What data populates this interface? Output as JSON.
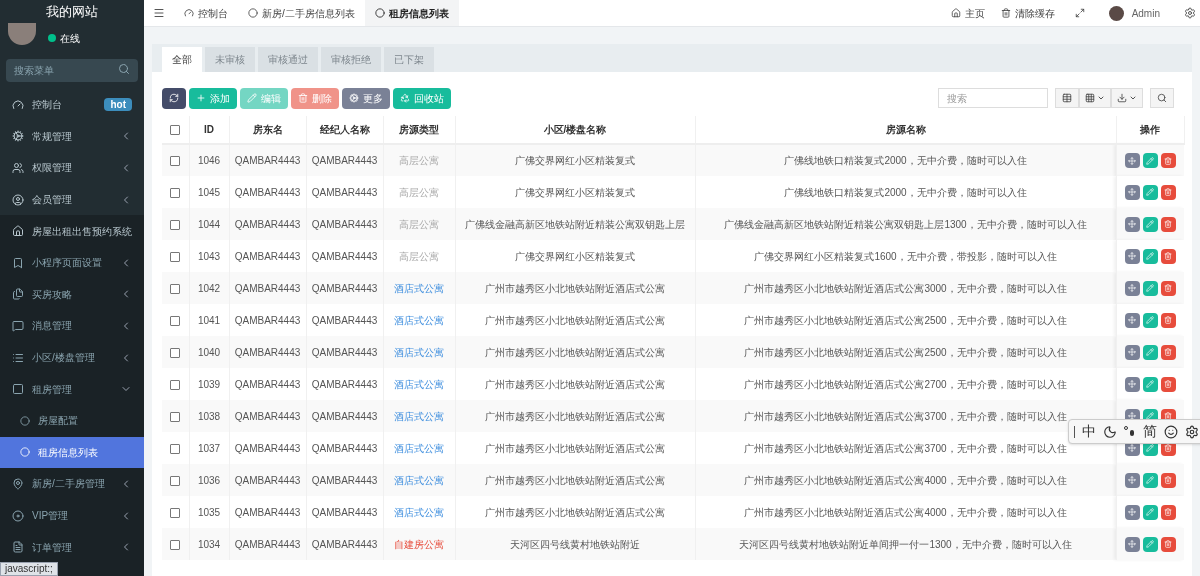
{
  "sidebar": {
    "logo": "我的网站",
    "user": {
      "status": "在线"
    },
    "search": {
      "placeholder": "搜索菜单"
    },
    "items": [
      {
        "label": "控制台",
        "badge": "hot",
        "selected": false
      },
      {
        "label": "常规管理",
        "expanded": false,
        "selected": false
      },
      {
        "label": "权限管理",
        "expanded": false,
        "selected": false
      },
      {
        "label": "会员管理",
        "expanded": false,
        "selected": false
      },
      {
        "label": "房屋出租出售预约系统",
        "expanded": true,
        "selected": false,
        "children": [
          {
            "label": "小程序页面设置",
            "expanded": false,
            "selected": false
          },
          {
            "label": "买房攻略",
            "expanded": false,
            "selected": false
          },
          {
            "label": "消息管理",
            "expanded": false,
            "selected": false
          },
          {
            "label": "小区/楼盘管理",
            "expanded": false,
            "selected": false
          },
          {
            "label": "租房管理",
            "expanded": true,
            "selected": false,
            "children": [
              {
                "label": "房屋配置",
                "selected": false
              },
              {
                "label": "租房信息列表",
                "selected": true
              }
            ]
          },
          {
            "label": "新房/二手房管理",
            "expanded": false,
            "selected": false
          },
          {
            "label": "VIP管理",
            "expanded": false,
            "selected": false
          },
          {
            "label": "订单管理",
            "expanded": false,
            "selected": false
          }
        ]
      }
    ]
  },
  "status_bar": "javascript:;",
  "top_tabs": [
    {
      "label": "控制台",
      "selected": false
    },
    {
      "label": "新房/二手房信息列表",
      "selected": false
    },
    {
      "label": "租房信息列表",
      "selected": true
    }
  ],
  "header_links": [
    {
      "label": "主页"
    },
    {
      "label": "清除缓存"
    }
  ],
  "user_name": "Admin",
  "filter_tabs": [
    {
      "label": "全部",
      "selected": true
    },
    {
      "label": "未审核",
      "selected": false
    },
    {
      "label": "审核通过",
      "selected": false
    },
    {
      "label": "审核拒绝",
      "selected": false
    },
    {
      "label": "已下架",
      "selected": false
    }
  ],
  "toolbar": [
    {
      "kind": "refresh",
      "disabled": false
    },
    {
      "kind": "add",
      "label": "添加",
      "disabled": false
    },
    {
      "kind": "edit",
      "label": "编辑",
      "disabled": true
    },
    {
      "kind": "delete",
      "label": "删除",
      "disabled": true
    },
    {
      "kind": "more",
      "label": "更多",
      "disabled": false
    },
    {
      "kind": "recycle",
      "label": "回收站",
      "disabled": false
    }
  ],
  "table_search": {
    "placeholder": "搜索"
  },
  "table": {
    "select_all_checked": false,
    "columns": [
      "ID",
      "房东名",
      "经纪人名称",
      "房源类型",
      "小区/楼盘名称",
      "房源名称",
      "操作"
    ],
    "rows": [
      {
        "checked": false,
        "id": "1046",
        "landlord": "QAMBAR4443",
        "agent": "QAMBAR4443",
        "type": {
          "kind": "high_rise",
          "text": "高层公寓"
        },
        "community": "广佛交界网红小区精装复式",
        "name": "广佛线地铁口精装复式2000，无中介费，随时可以入住"
      },
      {
        "checked": false,
        "id": "1045",
        "landlord": "QAMBAR4443",
        "agent": "QAMBAR4443",
        "type": {
          "kind": "high_rise",
          "text": "高层公寓"
        },
        "community": "广佛交界网红小区精装复式",
        "name": "广佛线地铁口精装复式2000，无中介费，随时可以入住"
      },
      {
        "checked": false,
        "id": "1044",
        "landlord": "QAMBAR4443",
        "agent": "QAMBAR4443",
        "type": {
          "kind": "high_rise",
          "text": "高层公寓"
        },
        "community": "广佛线金融高新区地铁站附近精装公寓双钥匙上层",
        "name": "广佛线金融高新区地铁站附近精装公寓双钥匙上层1300，无中介费，随时可以入住"
      },
      {
        "checked": false,
        "id": "1043",
        "landlord": "QAMBAR4443",
        "agent": "QAMBAR4443",
        "type": {
          "kind": "high_rise",
          "text": "高层公寓"
        },
        "community": "广佛交界网红小区精装复式",
        "name": "广佛交界网红小区精装复式1600，无中介费，带投影，随时可以入住"
      },
      {
        "checked": false,
        "id": "1042",
        "landlord": "QAMBAR4443",
        "agent": "QAMBAR4443",
        "type": {
          "kind": "hotel",
          "text": "酒店式公寓"
        },
        "community": "广州市越秀区小北地铁站附近酒店式公寓",
        "name": "广州市越秀区小北地铁站附近酒店式公寓3000，无中介费，随时可以入住"
      },
      {
        "checked": false,
        "id": "1041",
        "landlord": "QAMBAR4443",
        "agent": "QAMBAR4443",
        "type": {
          "kind": "hotel",
          "text": "酒店式公寓"
        },
        "community": "广州市越秀区小北地铁站附近酒店式公寓",
        "name": "广州市越秀区小北地铁站附近酒店式公寓2500，无中介费，随时可以入住"
      },
      {
        "checked": false,
        "id": "1040",
        "landlord": "QAMBAR4443",
        "agent": "QAMBAR4443",
        "type": {
          "kind": "hotel",
          "text": "酒店式公寓"
        },
        "community": "广州市越秀区小北地铁站附近酒店式公寓",
        "name": "广州市越秀区小北地铁站附近酒店式公寓2500，无中介费，随时可以入住"
      },
      {
        "checked": false,
        "id": "1039",
        "landlord": "QAMBAR4443",
        "agent": "QAMBAR4443",
        "type": {
          "kind": "hotel",
          "text": "酒店式公寓"
        },
        "community": "广州市越秀区小北地铁站附近酒店式公寓",
        "name": "广州市越秀区小北地铁站附近酒店式公寓2700，无中介费，随时可以入住"
      },
      {
        "checked": false,
        "id": "1038",
        "landlord": "QAMBAR4443",
        "agent": "QAMBAR4443",
        "type": {
          "kind": "hotel",
          "text": "酒店式公寓"
        },
        "community": "广州市越秀区小北地铁站附近酒店式公寓",
        "name": "广州市越秀区小北地铁站附近酒店式公寓3700，无中介费，随时可以入住"
      },
      {
        "checked": false,
        "id": "1037",
        "landlord": "QAMBAR4443",
        "agent": "QAMBAR4443",
        "type": {
          "kind": "hotel",
          "text": "酒店式公寓"
        },
        "community": "广州市越秀区小北地铁站附近酒店式公寓",
        "name": "广州市越秀区小北地铁站附近酒店式公寓3700，无中介费，随时可以入住"
      },
      {
        "checked": false,
        "id": "1036",
        "landlord": "QAMBAR4443",
        "agent": "QAMBAR4443",
        "type": {
          "kind": "hotel",
          "text": "酒店式公寓"
        },
        "community": "广州市越秀区小北地铁站附近酒店式公寓",
        "name": "广州市越秀区小北地铁站附近酒店式公寓4000，无中介费，随时可以入住"
      },
      {
        "checked": false,
        "id": "1035",
        "landlord": "QAMBAR4443",
        "agent": "QAMBAR4443",
        "type": {
          "kind": "hotel",
          "text": "酒店式公寓"
        },
        "community": "广州市越秀区小北地铁站附近酒店式公寓",
        "name": "广州市越秀区小北地铁站附近酒店式公寓4000，无中介费，随时可以入住"
      },
      {
        "checked": false,
        "id": "1034",
        "landlord": "QAMBAR4443",
        "agent": "QAMBAR4443",
        "type": {
          "kind": "self_built",
          "text": "自建房公寓"
        },
        "community": "天河区四号线黄村地铁站附近",
        "name": "天河区四号线黄村地铁站附近单间押一付一1300，无中介费，随时可以入住"
      }
    ]
  },
  "ime_toolbar": {
    "mode": "中",
    "script": "简"
  }
}
